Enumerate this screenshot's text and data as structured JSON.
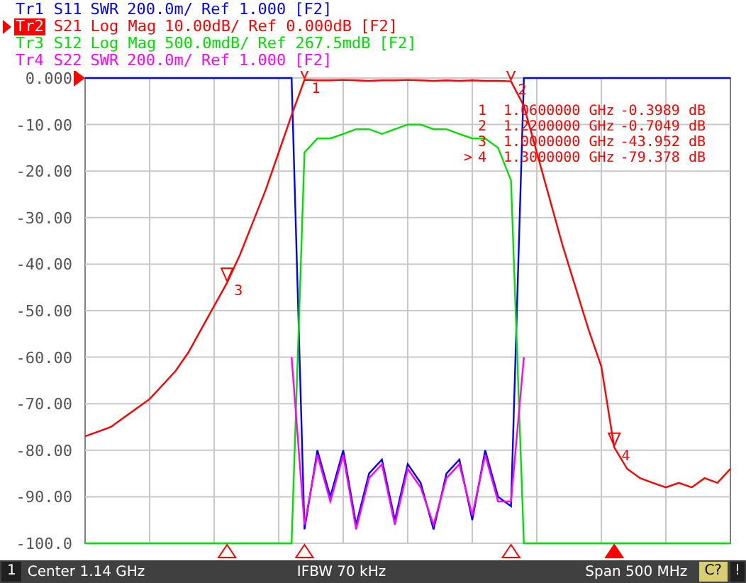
{
  "traces": [
    {
      "parameter": "S11",
      "format": "SWR",
      "scale": "200.0m/",
      "reference": "Ref 1.000",
      "tag": "[F2]",
      "color": "#0000ff",
      "selected": false
    },
    {
      "parameter": "S21",
      "format": "Log Mag",
      "scale": "10.00dB/",
      "reference": "Ref 0.000dB",
      "tag": "[F2]",
      "color": "#ff0000",
      "selected": true
    },
    {
      "parameter": "S12",
      "format": "Log Mag",
      "scale": "500.0mdB/",
      "reference": "Ref 267.5mdB",
      "tag": "[F2]",
      "color": "#00e000",
      "selected": false
    },
    {
      "parameter": "S22",
      "format": "SWR",
      "scale": "200.0m/",
      "reference": "Ref 1.000",
      "tag": "[F2]",
      "color": "#ff00ff",
      "selected": false
    }
  ],
  "markers": [
    {
      "chart_label": "1",
      "number": "1",
      "frequency": "1.0600000 GHz",
      "value": "-0.3989 dB",
      "selected": false
    },
    {
      "chart_label": "2",
      "number": "2",
      "frequency": "1.2200000 GHz",
      "value": "-0.7049 dB",
      "selected": false
    },
    {
      "chart_label": "3",
      "number": "3",
      "frequency": "1.0000000 GHz",
      "value": "-43.952 dB",
      "selected": false
    },
    {
      "chart_label": "4",
      "pointer": ">",
      "number": "4",
      "frequency": "1.3000000 GHz",
      "value": "-79.378 dB",
      "selected": true
    }
  ],
  "chart_data": {
    "type": "line",
    "grid": true,
    "categories": [
      null,
      null,
      null,
      null,
      null,
      null,
      null,
      null,
      null,
      null,
      null,
      null,
      null,
      null,
      null,
      null,
      null,
      null,
      null,
      null,
      null,
      null,
      null,
      null,
      null,
      null,
      null,
      null,
      null,
      null,
      null,
      null,
      null,
      null,
      null,
      null,
      null,
      null,
      null,
      null,
      null,
      null,
      null,
      null,
      null,
      null,
      null,
      null,
      null,
      null,
      null
    ],
    "ylim": [
      -100,
      0
    ],
    "yticks": [
      {
        "value": 0,
        "label": "0.000"
      },
      {
        "value": -10,
        "label": "-10.00"
      },
      {
        "value": -20,
        "label": "-20.00"
      },
      {
        "value": -30,
        "label": "-30.00"
      },
      {
        "value": -40,
        "label": "-40.00"
      },
      {
        "value": -50,
        "label": "-50.00"
      },
      {
        "value": -60,
        "label": "-60.00"
      },
      {
        "value": -70,
        "label": "-70.00"
      },
      {
        "value": -80,
        "label": "-80.00"
      },
      {
        "value": -90,
        "label": "-90.00"
      },
      {
        "value": -100,
        "label": "-100.0"
      }
    ],
    "series": [
      {
        "name": "Tr1",
        "color": "#0000ff",
        "values": [
          0,
          0,
          0,
          0,
          0,
          0,
          0,
          0,
          0,
          0,
          0,
          0,
          0,
          0,
          0,
          0,
          0,
          -97,
          -80,
          -90,
          -80,
          -96,
          -85,
          -82,
          -95,
          -83,
          -87,
          -97,
          -85,
          -82,
          -95,
          -80,
          -90,
          -92,
          0,
          0,
          0,
          0,
          0,
          0,
          0,
          0,
          0,
          0,
          0,
          0,
          0,
          0,
          0,
          0,
          0
        ]
      },
      {
        "name": "Tr2",
        "color": "#ff0000",
        "values": [
          -77,
          -76,
          -75,
          -73,
          -71,
          -69,
          -66,
          -63,
          -59,
          -54,
          -49,
          -44,
          -38,
          -31,
          -24,
          -16,
          -8,
          -0.4,
          -0.5,
          -0.5,
          -0.4,
          -0.5,
          -0.6,
          -0.5,
          -0.5,
          -0.4,
          -0.5,
          -0.6,
          -0.5,
          -0.6,
          -0.5,
          -0.6,
          -0.6,
          -0.7,
          -6,
          -16,
          -26,
          -36,
          -45,
          -54,
          -62,
          -79.4,
          -84,
          -86,
          -87,
          -88,
          -87,
          -88,
          -86,
          -87,
          -84
        ]
      },
      {
        "name": "Tr3",
        "color": "#00e000",
        "values": [
          -100,
          -100,
          -100,
          -100,
          -100,
          -100,
          -100,
          -100,
          -100,
          -100,
          -100,
          -100,
          -100,
          -100,
          -100,
          -100,
          -100,
          -16,
          -13,
          -13,
          -12,
          -11,
          -11,
          -12,
          -11,
          -10,
          -10,
          -11,
          -11,
          -12,
          -13,
          -13,
          -15,
          -22,
          -100,
          -100,
          -100,
          -100,
          -100,
          -100,
          -100,
          -100,
          -100,
          -100,
          -100,
          -100,
          -100,
          -100,
          -100,
          -100,
          -100
        ]
      },
      {
        "name": "Tr4",
        "color": "#ff00ff",
        "values": [
          null,
          null,
          null,
          null,
          null,
          null,
          null,
          null,
          null,
          null,
          null,
          null,
          null,
          null,
          null,
          null,
          -60,
          -96,
          -81,
          -91,
          -81,
          -97,
          -86,
          -83,
          -96,
          -84,
          -88,
          -96,
          -86,
          -83,
          -94,
          -81,
          -91,
          -91,
          -60,
          null,
          null,
          null,
          null,
          null,
          null,
          null,
          null,
          null,
          null,
          null,
          null,
          null,
          null,
          null,
          null
        ]
      }
    ]
  },
  "status_bar": {
    "channel": "1",
    "center": "Center 1.14 GHz",
    "ifbw": "IFBW 70 kHz",
    "span": "Span 500 MHz",
    "correction": "C?",
    "alert": "!"
  }
}
